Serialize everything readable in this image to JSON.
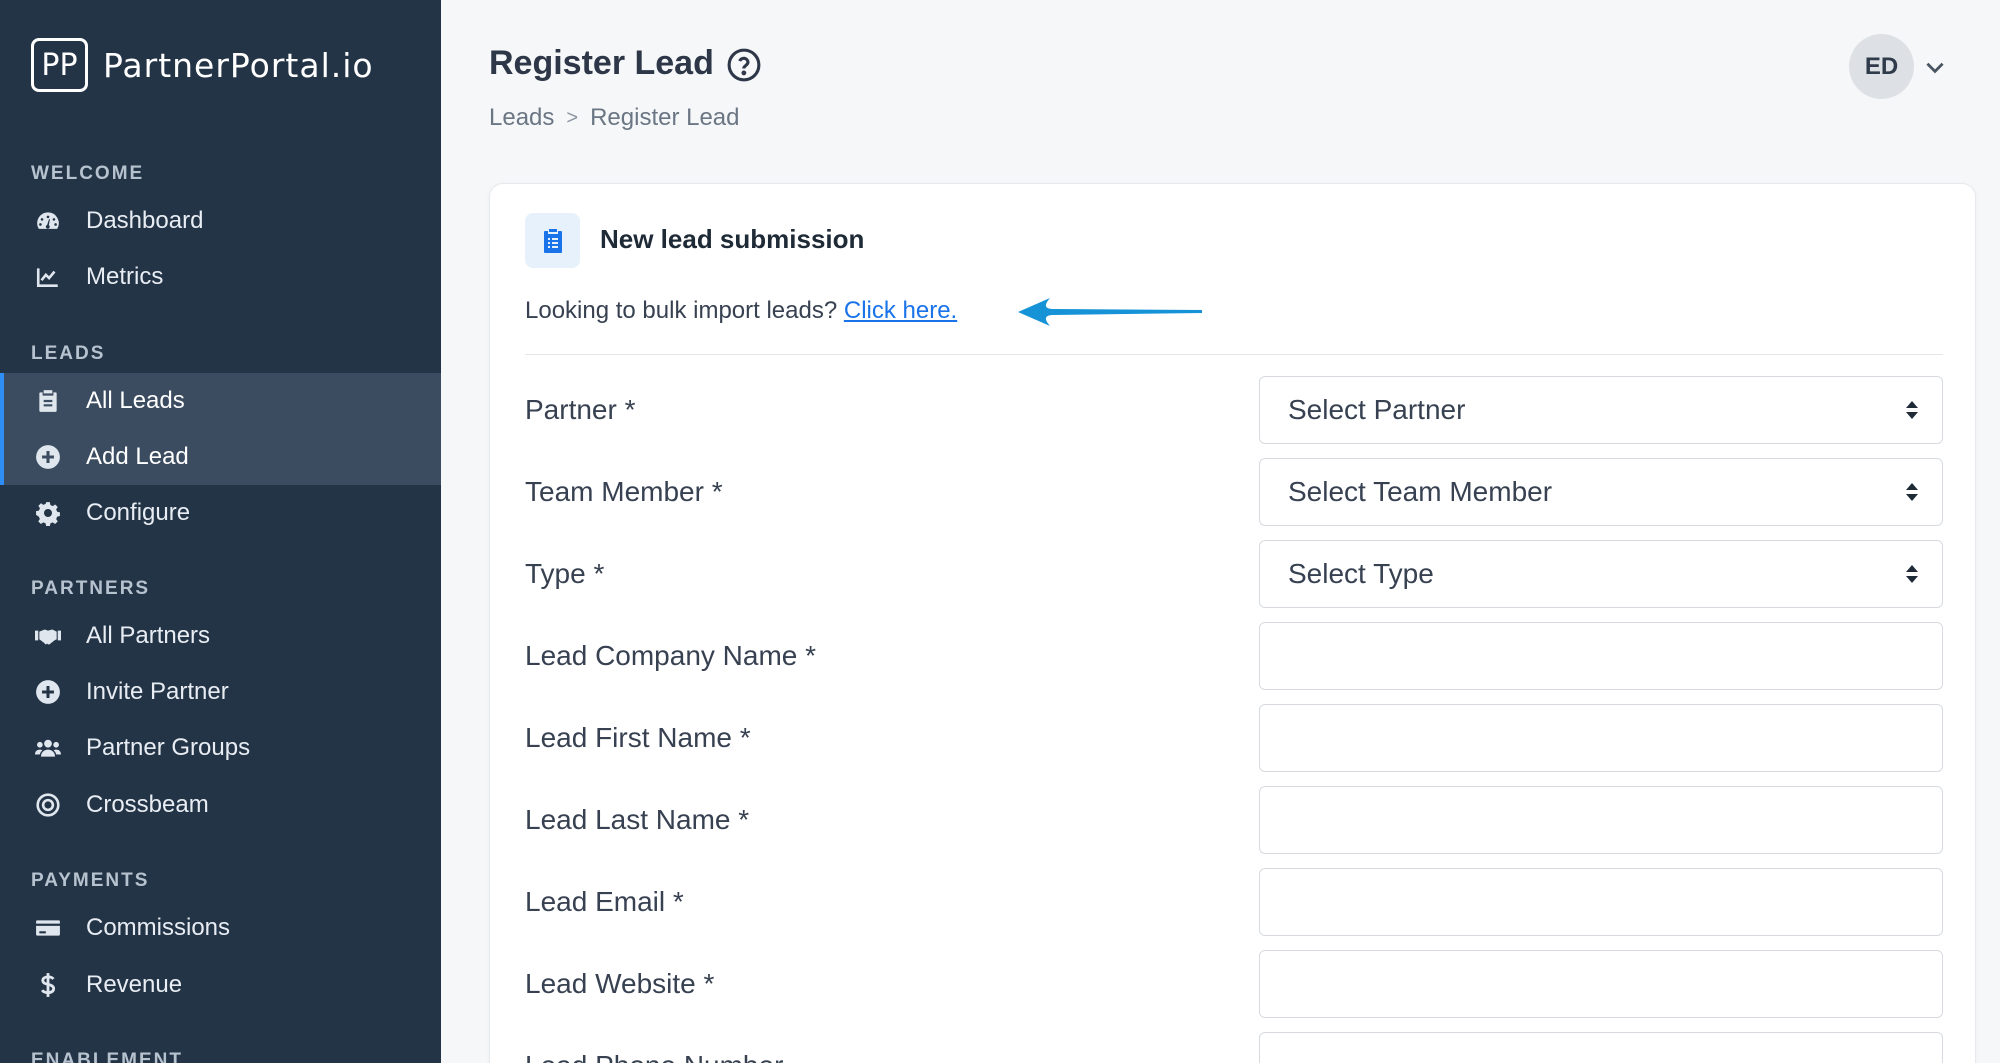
{
  "brand": {
    "logo_text": "PP",
    "name": "PartnerPortal.io"
  },
  "sidebar": {
    "sections": [
      {
        "label": "WELCOME",
        "items": [
          {
            "label": "Dashboard",
            "icon": "gauge-icon"
          },
          {
            "label": "Metrics",
            "icon": "line-chart-icon"
          }
        ]
      },
      {
        "label": "LEADS",
        "items": [
          {
            "label": "All Leads",
            "icon": "clipboard-icon"
          },
          {
            "label": "Add Lead",
            "icon": "plus-circle-icon"
          },
          {
            "label": "Configure",
            "icon": "gear-icon"
          }
        ]
      },
      {
        "label": "PARTNERS",
        "items": [
          {
            "label": "All Partners",
            "icon": "handshake-icon"
          },
          {
            "label": "Invite Partner",
            "icon": "plus-circle-icon"
          },
          {
            "label": "Partner Groups",
            "icon": "users-icon"
          },
          {
            "label": "Crossbeam",
            "icon": "target-icon"
          }
        ]
      },
      {
        "label": "PAYMENTS",
        "items": [
          {
            "label": "Commissions",
            "icon": "credit-card-icon"
          },
          {
            "label": "Revenue",
            "icon": "dollar-icon"
          }
        ]
      },
      {
        "label": "ENABLEMENT",
        "items": []
      }
    ]
  },
  "header": {
    "title": "Register Lead",
    "breadcrumb": [
      "Leads",
      ">",
      "Register Lead"
    ],
    "avatar_initials": "ED"
  },
  "card": {
    "title": "New lead submission",
    "bulk_text": "Looking to bulk import leads?",
    "bulk_link": "Click here.",
    "fields": [
      {
        "label": "Partner *",
        "type": "select",
        "value": "Select Partner"
      },
      {
        "label": "Team Member *",
        "type": "select",
        "value": "Select Team Member"
      },
      {
        "label": "Type *",
        "type": "select",
        "value": "Select Type"
      },
      {
        "label": "Lead Company Name *",
        "type": "text",
        "value": ""
      },
      {
        "label": "Lead First Name *",
        "type": "text",
        "value": ""
      },
      {
        "label": "Lead Last Name *",
        "type": "text",
        "value": ""
      },
      {
        "label": "Lead Email *",
        "type": "text",
        "value": ""
      },
      {
        "label": "Lead Website *",
        "type": "text",
        "value": ""
      },
      {
        "label": "Lead Phone Number",
        "type": "text",
        "value": ""
      }
    ]
  },
  "colors": {
    "sidebar_bg": "#243447",
    "active_bar": "#2f8ef5",
    "link": "#1a73e8",
    "arrow": "#1593d6"
  }
}
